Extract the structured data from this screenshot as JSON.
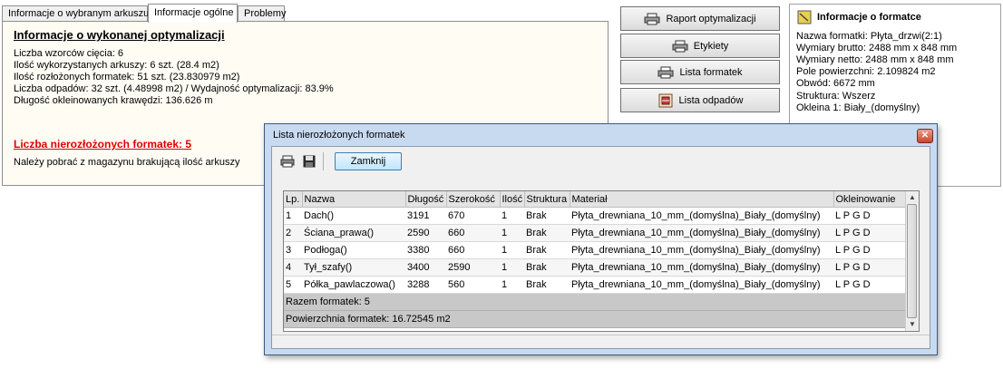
{
  "tabs": [
    "Informacje o wybranym arkuszu",
    "Informacje ogólne",
    "Problemy"
  ],
  "summary": {
    "heading": "Informacje o wykonanej optymalizacji",
    "lines": [
      "Liczba wzorców cięcia: 6",
      "Ilość wykorzystanych arkuszy: 6 szt. (28.4 m2)",
      "Ilość rozłożonych formatek: 51 szt. (23.830979 m2)",
      "Liczba odpadów: 32 szt. (4.48998 m2) / Wydajność optymalizacji: 83.9%",
      "Długość okleinowanych krawędzi: 136.626 m"
    ],
    "alert": "Liczba nierozłożonych formatek: 5",
    "note": "Należy pobrać z magazynu brakującą ilość arkuszy"
  },
  "buttons": {
    "report": "Raport optymalizacji",
    "labels": "Etykiety",
    "pieces": "Lista formatek",
    "waste": "Lista odpadów"
  },
  "info": {
    "title": "Informacje o formatce",
    "rows": [
      "Nazwa formatki: Płyta_drzwi(2:1)",
      "Wymiary brutto: 2488 mm x 848 mm",
      "Wymiary netto: 2488 mm x 848 mm",
      "Pole powierzchni: 2.109824 m2",
      "Obwód: 6672 mm",
      "Struktura: Wszerz",
      "Okleina 1: Biały_(domyślny)"
    ]
  },
  "dialog": {
    "title": "Lista nierozłożonych formatek",
    "close_label": "Zamknij",
    "columns": [
      "Lp.",
      "Nazwa",
      "Długość",
      "Szerokość",
      "Ilość",
      "Struktura",
      "Materiał",
      "Okleinowanie"
    ],
    "rows": [
      [
        "1",
        "Dach()",
        "3191",
        "670",
        "1",
        "Brak",
        "Płyta_drewniana_10_mm_(domyślna)_Biały_(domyślny)",
        "L P G D"
      ],
      [
        "2",
        "Ściana_prawa()",
        "2590",
        "660",
        "1",
        "Brak",
        "Płyta_drewniana_10_mm_(domyślna)_Biały_(domyślny)",
        "L P G D"
      ],
      [
        "3",
        "Podłoga()",
        "3380",
        "660",
        "1",
        "Brak",
        "Płyta_drewniana_10_mm_(domyślna)_Biały_(domyślny)",
        "L P G D"
      ],
      [
        "4",
        "Tył_szafy()",
        "3400",
        "2590",
        "1",
        "Brak",
        "Płyta_drewniana_10_mm_(domyślna)_Biały_(domyślny)",
        "L P G D"
      ],
      [
        "5",
        "Półka_pawlaczowa()",
        "3288",
        "560",
        "1",
        "Brak",
        "Płyta_drewniana_10_mm_(domyślna)_Biały_(domyślny)",
        "L P G D"
      ]
    ],
    "total_count": "Razem formatek: 5",
    "total_area": "Powierzchnia formatek: 16.72545 m2"
  }
}
